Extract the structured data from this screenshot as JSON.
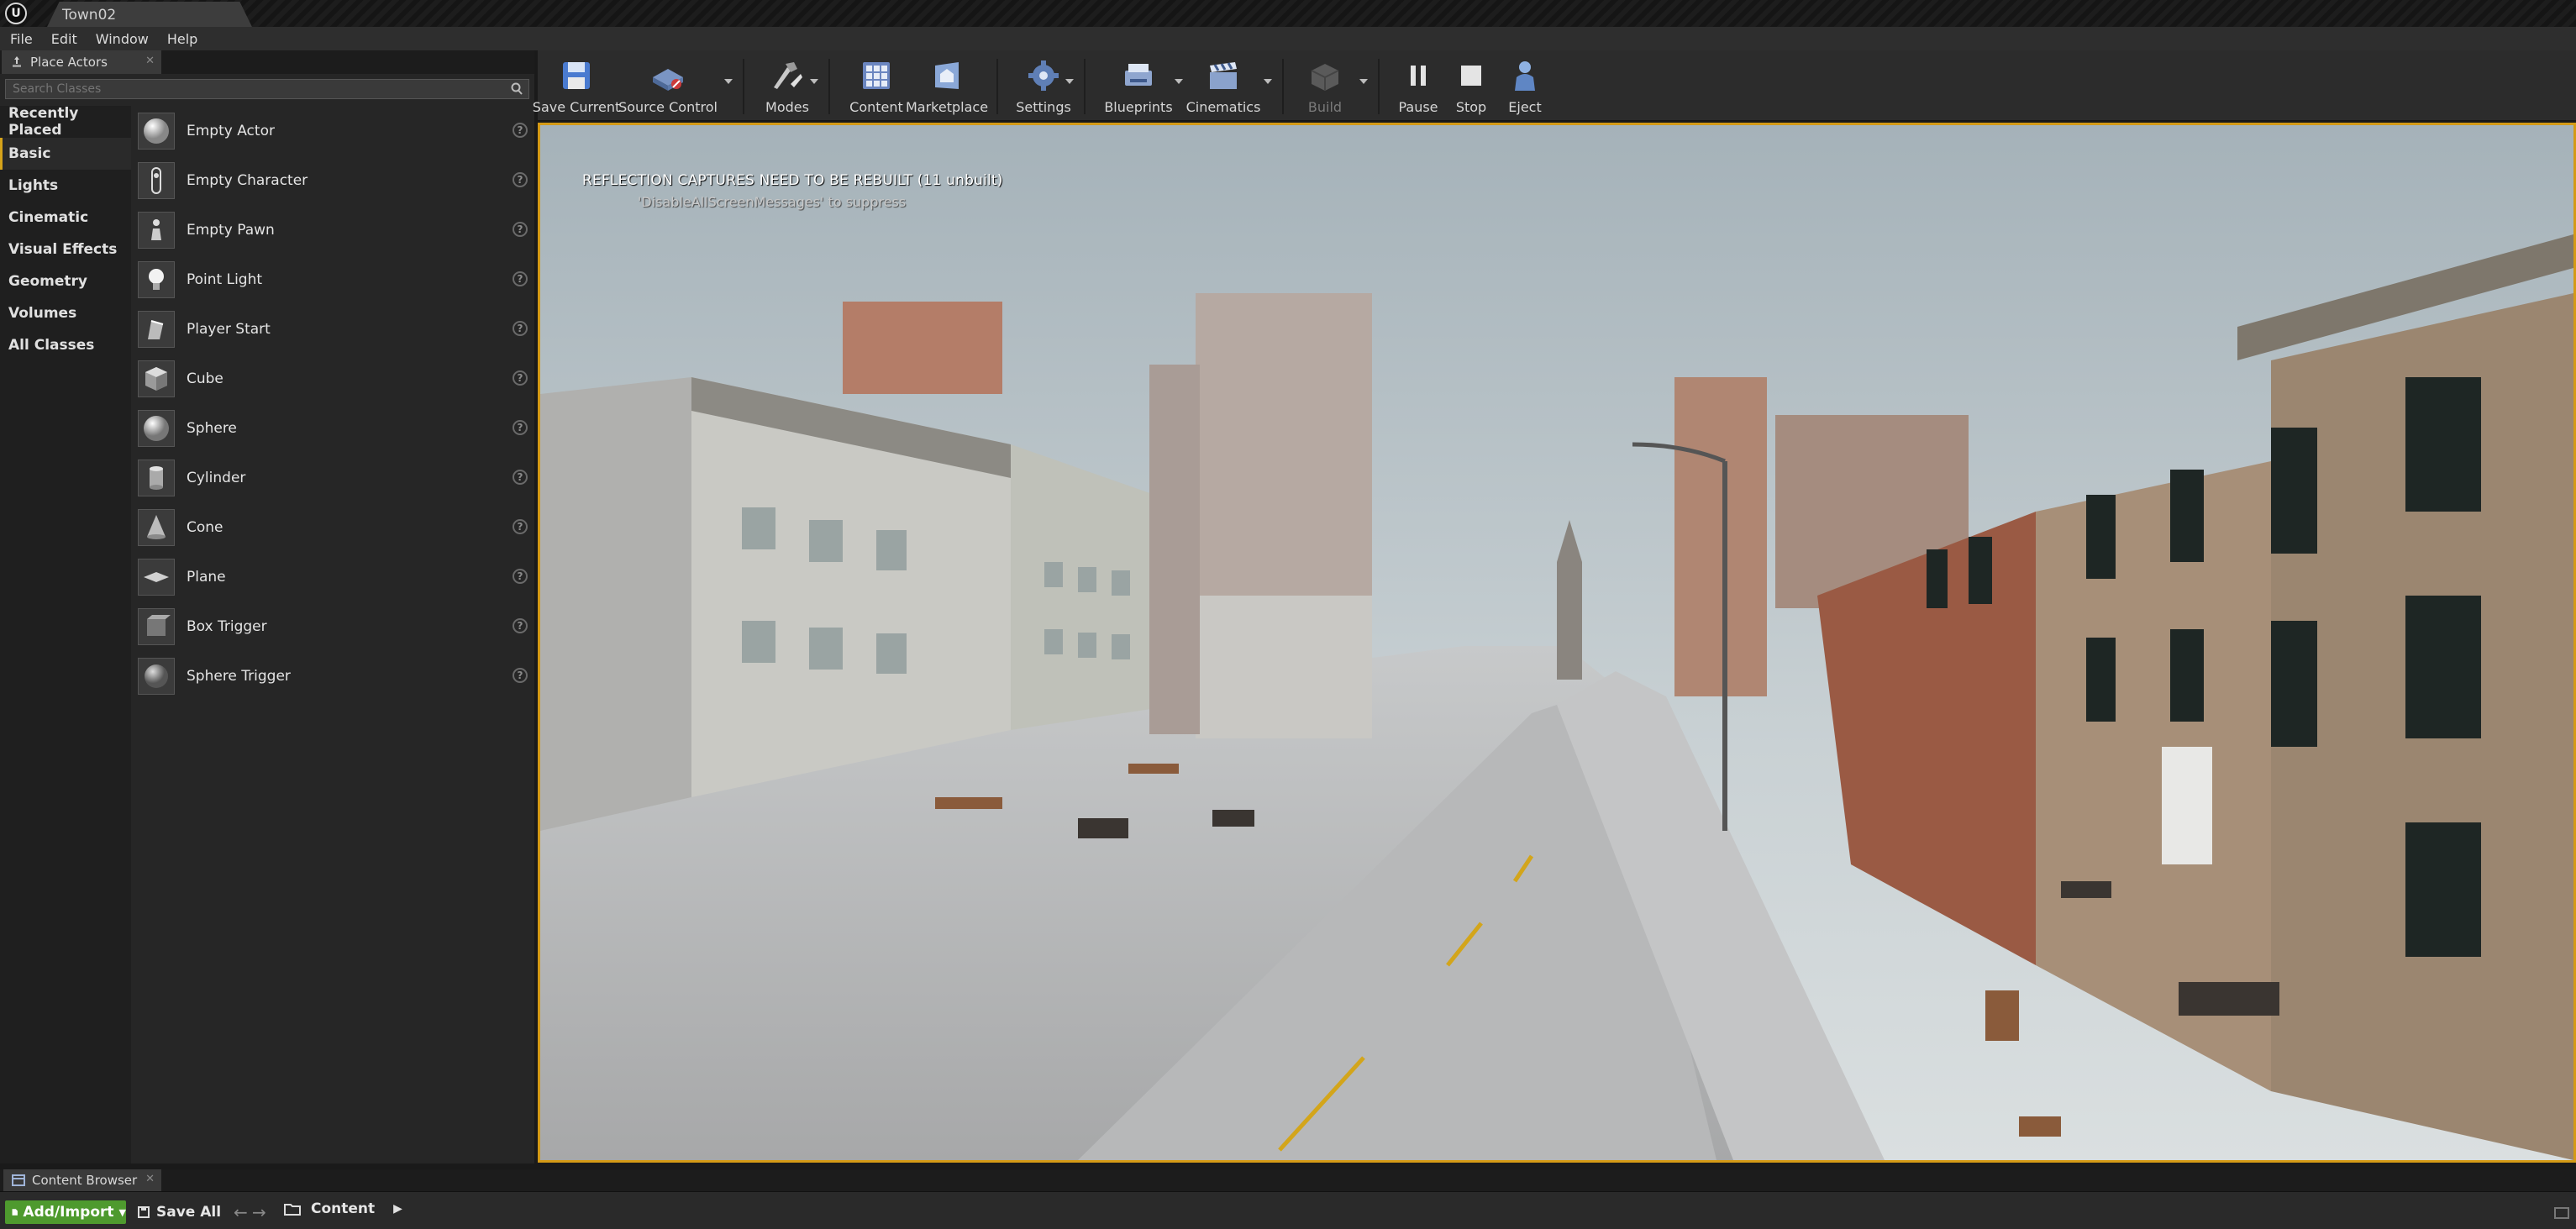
{
  "window": {
    "tab_title": "Town02"
  },
  "menu": [
    "File",
    "Edit",
    "Window",
    "Help"
  ],
  "place_actors": {
    "tab_label": "Place Actors",
    "search_placeholder": "Search Classes",
    "categories": [
      "Recently Placed",
      "Basic",
      "Lights",
      "Cinematic",
      "Visual Effects",
      "Geometry",
      "Volumes",
      "All Classes"
    ],
    "active_category": "Basic",
    "actors": [
      {
        "label": "Empty Actor",
        "icon": "sphere-icon"
      },
      {
        "label": "Empty Character",
        "icon": "character-icon"
      },
      {
        "label": "Empty Pawn",
        "icon": "pawn-icon"
      },
      {
        "label": "Point Light",
        "icon": "lightbulb-icon"
      },
      {
        "label": "Player Start",
        "icon": "player-start-icon"
      },
      {
        "label": "Cube",
        "icon": "cube-icon"
      },
      {
        "label": "Sphere",
        "icon": "sphere-icon"
      },
      {
        "label": "Cylinder",
        "icon": "cylinder-icon"
      },
      {
        "label": "Cone",
        "icon": "cone-icon"
      },
      {
        "label": "Plane",
        "icon": "plane-icon"
      },
      {
        "label": "Box Trigger",
        "icon": "box-trigger-icon"
      },
      {
        "label": "Sphere Trigger",
        "icon": "sphere-trigger-icon"
      }
    ]
  },
  "toolbar": {
    "save_current": "Save Current",
    "source_control": "Source Control",
    "modes": "Modes",
    "content": "Content",
    "marketplace": "Marketplace",
    "settings": "Settings",
    "blueprints": "Blueprints",
    "cinematics": "Cinematics",
    "build": "Build",
    "pause": "Pause",
    "stop": "Stop",
    "eject": "Eject"
  },
  "viewport": {
    "message": "REFLECTION CAPTURES NEED TO BE REBUILT (11 unbuilt)",
    "hint": "'DisableAllScreenMessages' to suppress"
  },
  "content_browser": {
    "tab_label": "Content Browser",
    "add_import": "Add/Import",
    "save_all": "Save All",
    "path": "Content"
  },
  "colors": {
    "viewport_border": "#d49a16",
    "add_import_bg": "#4e9a2e",
    "active_category_accent": "#d6a31a"
  }
}
